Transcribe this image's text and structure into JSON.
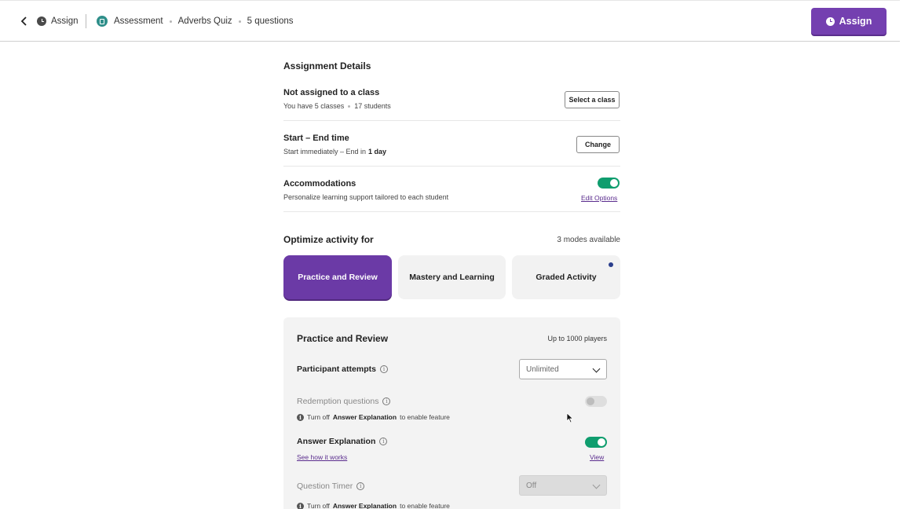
{
  "header": {
    "back_label": "Assign",
    "assessment_label": "Assessment",
    "quiz_title": "Adverbs Quiz",
    "question_count": "5 questions",
    "assign_button": "Assign"
  },
  "details": {
    "title": "Assignment Details",
    "class_row": {
      "title": "Not assigned to a class",
      "classes": "You have 5 classes",
      "students": "17 students",
      "button": "Select a class"
    },
    "time_row": {
      "title": "Start – End time",
      "sub_prefix": "Start immediately – End in",
      "sub_bold": "1 day",
      "button": "Change"
    },
    "accommodations": {
      "title": "Accommodations",
      "sub": "Personalize learning support tailored to each student",
      "enabled": true,
      "link": "Edit Options"
    }
  },
  "optimize": {
    "title": "Optimize activity for",
    "modes_available": "3 modes available",
    "modes": [
      {
        "label": "Practice and Review",
        "active": true
      },
      {
        "label": "Mastery and Learning",
        "active": false
      },
      {
        "label": "Graded Activity",
        "active": false
      }
    ]
  },
  "panel": {
    "title": "Practice and Review",
    "players": "Up to 1000 players",
    "attempts_label": "Participant attempts",
    "attempts_value": "Unlimited",
    "redemption_label": "Redemption questions",
    "redemption_enabled": false,
    "note_prefix": "Turn off",
    "note_bold": "Answer Explanation",
    "note_suffix": "to enable feature",
    "explanation_label": "Answer Explanation",
    "explanation_enabled": true,
    "see_how": "See how it works",
    "view": "View",
    "timer_label": "Question Timer",
    "timer_value": "Off"
  },
  "icons": {
    "back": "chevron-left-icon",
    "clock": "clock-icon",
    "quiz": "quiz-icon",
    "info": "info-icon"
  },
  "colors": {
    "accent": "#7440b0",
    "toggle_on": "#0f9d6e",
    "link": "#5b2d8e"
  }
}
